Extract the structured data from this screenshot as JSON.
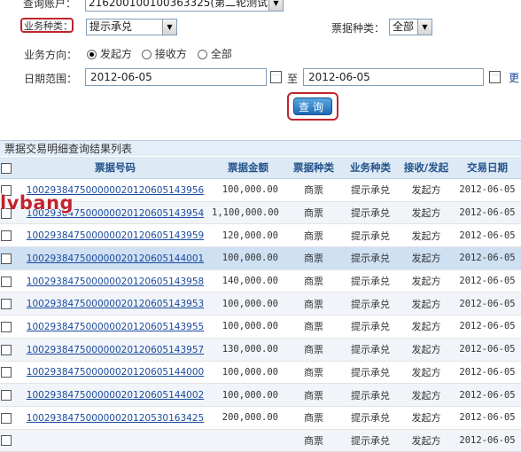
{
  "query_form": {
    "account_label": "查询账户：",
    "account_value": "21620010010036332​5(第二轮测试1)",
    "business_type_label": "业务种类：",
    "business_type_value": "提示承兑",
    "bill_type_label": "票据种类：",
    "bill_type_value": "全部",
    "direction_label": "业务方向：",
    "direction_options": [
      "发起方",
      "接收方",
      "全部"
    ],
    "direction_selected": "发起方",
    "date_range_label": "日期范围：",
    "date_from": "2012-06-05",
    "date_to_label": "至",
    "date_to": "2012-06-05",
    "more_link": "更",
    "query_button": "查询"
  },
  "results": {
    "title": "票据交易明细查询结果列表",
    "columns": [
      "票据号码",
      "票据金额",
      "票据种类",
      "业务种类",
      "接收/发起",
      "交易日期"
    ],
    "rows": [
      {
        "bill_no": "10029384750000002012060514395​6",
        "amount": "100,000.00",
        "bill_type": "商票",
        "biz_type": "提示承兑",
        "role": "发起方",
        "date": "2012-06-05"
      },
      {
        "bill_no": "100293847500000020120605143954",
        "amount": "1,100,000.00",
        "bill_type": "商票",
        "biz_type": "提示承兑",
        "role": "发起方",
        "date": "2012-06-05"
      },
      {
        "bill_no": "100293847500000020120605143959",
        "amount": "120,000.00",
        "bill_type": "商票",
        "biz_type": "提示承兑",
        "role": "发起方",
        "date": "2012-06-05"
      },
      {
        "bill_no": "100293847500000020120605144001",
        "amount": "100,000.00",
        "bill_type": "商票",
        "biz_type": "提示承兑",
        "role": "发起方",
        "date": "2012-06-05"
      },
      {
        "bill_no": "100293847500000020120605143958",
        "amount": "140,000.00",
        "bill_type": "商票",
        "biz_type": "提示承兑",
        "role": "发起方",
        "date": "2012-06-05"
      },
      {
        "bill_no": "100293847500000020120605143953",
        "amount": "100,000.00",
        "bill_type": "商票",
        "biz_type": "提示承兑",
        "role": "发起方",
        "date": "2012-06-05"
      },
      {
        "bill_no": "100293847500000020120605143955",
        "amount": "100,000.00",
        "bill_type": "商票",
        "biz_type": "提示承兑",
        "role": "发起方",
        "date": "2012-06-05"
      },
      {
        "bill_no": "100293847500000020120605143957",
        "amount": "130,000.00",
        "bill_type": "商票",
        "biz_type": "提示承兑",
        "role": "发起方",
        "date": "2012-06-05"
      },
      {
        "bill_no": "100293847500000020120605144000",
        "amount": "100,000.00",
        "bill_type": "商票",
        "biz_type": "提示承兑",
        "role": "发起方",
        "date": "2012-06-05"
      },
      {
        "bill_no": "100293847500000020120605144002",
        "amount": "100,000.00",
        "bill_type": "商票",
        "biz_type": "提示承兑",
        "role": "发起方",
        "date": "2012-06-05"
      },
      {
        "bill_no": "100293847500000020120530163425",
        "amount": "200,000.00",
        "bill_type": "商票",
        "biz_type": "提示承兑",
        "role": "发起方",
        "date": "2012-06-05"
      },
      {
        "bill_no": "",
        "amount": "",
        "bill_type": "商票",
        "biz_type": "提示承兑",
        "role": "发起方",
        "date": "2012-06-05"
      }
    ]
  },
  "watermark": "lvbang",
  "colors": {
    "accent_red": "#c0242e",
    "header_blue": "#23538a",
    "link_blue": "#1a4a9e",
    "button_blue": "#1f6bb5"
  }
}
